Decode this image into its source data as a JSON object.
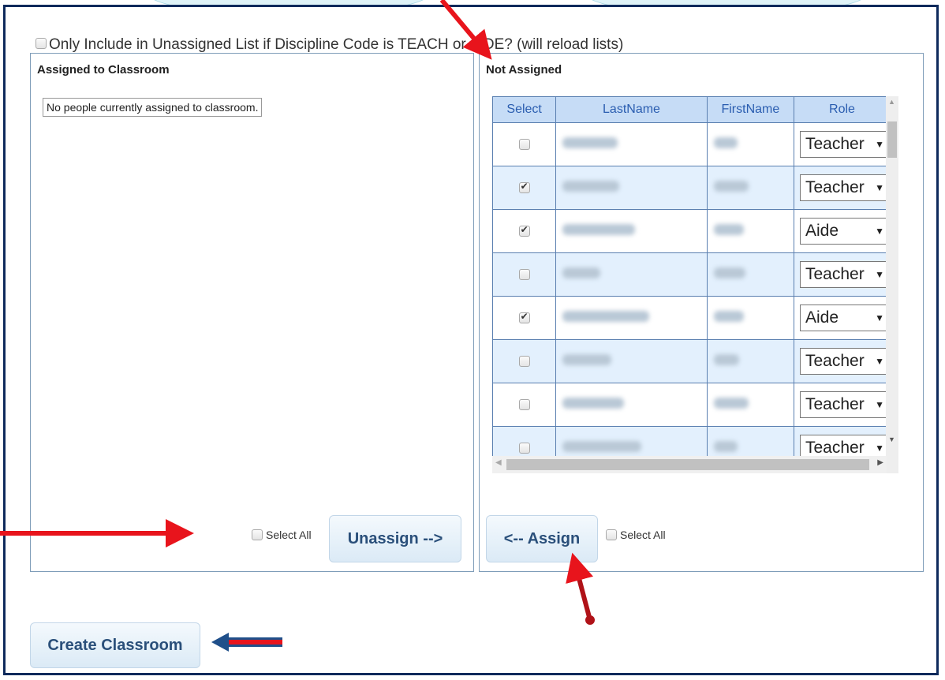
{
  "options": {
    "discipline_filter_label": "Only Include in Unassigned List if Discipline Code is TEACH or AIDE? (will reload lists)"
  },
  "assigned_panel": {
    "title": "Assigned to Classroom",
    "empty_message": "No people currently assigned to classroom.",
    "select_all_label": "Select All",
    "unassign_button": "Unassign -->"
  },
  "not_assigned_panel": {
    "title": "Not Assigned",
    "columns": [
      "Select",
      "LastName",
      "FirstName",
      "Role"
    ],
    "rows": [
      {
        "checked": false,
        "role": "Teacher"
      },
      {
        "checked": true,
        "role": "Teacher"
      },
      {
        "checked": true,
        "role": "Aide"
      },
      {
        "checked": false,
        "role": "Teacher"
      },
      {
        "checked": true,
        "role": "Aide"
      },
      {
        "checked": false,
        "role": "Teacher"
      },
      {
        "checked": false,
        "role": "Teacher"
      },
      {
        "checked": false,
        "role": "Teacher"
      }
    ],
    "select_all_label": "Select All",
    "assign_button": "<-- Assign"
  },
  "create_button": "Create Classroom",
  "colors": {
    "frame": "#0e2a5c",
    "header_bg": "#c6dcf6",
    "alt_row": "#e3f0fd",
    "annotation_red": "#e8141c",
    "annotation_blue": "#1f4f8a"
  }
}
